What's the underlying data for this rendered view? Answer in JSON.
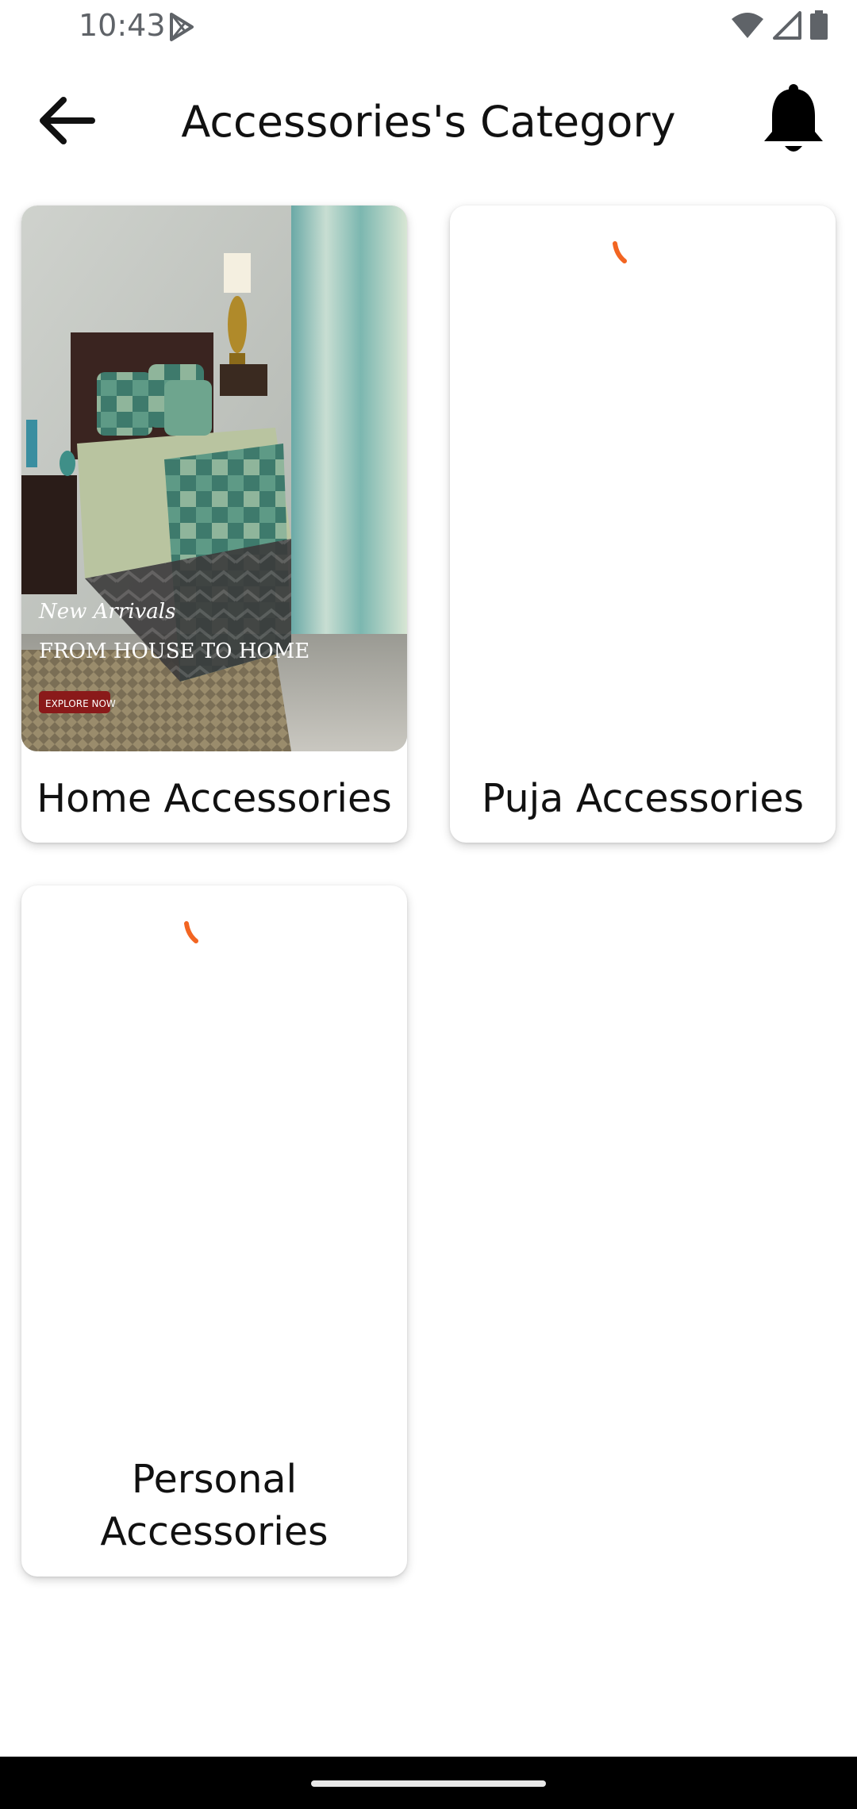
{
  "status_bar": {
    "time": "10:43",
    "icons": [
      "play-store-icon",
      "wifi-icon",
      "signal-icon",
      "battery-icon"
    ]
  },
  "app_bar": {
    "title": "Accessories's Category",
    "back_icon": "arrow-back-icon",
    "notification_icon": "bell-icon"
  },
  "categories": [
    {
      "label": "Home Accessories",
      "image": {
        "description_overlay_lines": [
          "New Arrivals",
          "FROM HOUSE TO HOME",
          "EXPLORE NOW"
        ]
      },
      "loading": false
    },
    {
      "label": "Puja Accessories",
      "loading": true
    },
    {
      "label": "Personal Accessories",
      "label_lines": [
        "Personal",
        "Accessories"
      ],
      "loading": true
    }
  ],
  "colors": {
    "spinner": "#f26522",
    "nav_bar": "#000000",
    "background": "#ffffff"
  }
}
